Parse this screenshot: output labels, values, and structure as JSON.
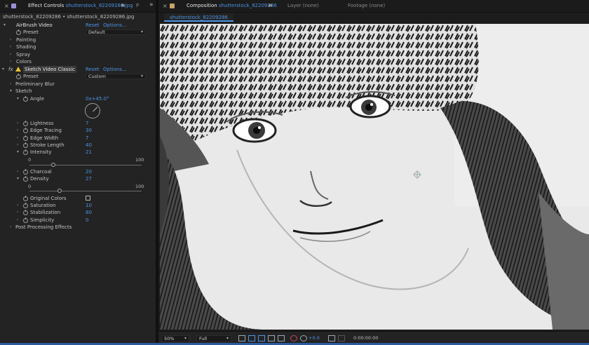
{
  "effect_controls": {
    "tab_title": "Effect Controls",
    "tab_file": "shutterstock_82209286.jpg",
    "next_tab": "P",
    "source_line": "shutterstock_82209286 • shutterstock_82209286.jpg"
  },
  "airbrush": {
    "name": "AirBrush Video",
    "reset": "Reset",
    "options": "Options...",
    "preset_label": "Preset",
    "preset_value": "Default",
    "groups": [
      "Painting",
      "Shading",
      "Spray",
      "Colors"
    ]
  },
  "sketch": {
    "fx": "fx",
    "name": "Sketch Video Classic",
    "reset": "Reset",
    "options": "Options...",
    "preset_label": "Preset",
    "preset_value": "Custom",
    "preliminary_blur": "Preliminary Blur",
    "sketch_group": "Sketch",
    "angle_label": "Angle",
    "angle_value": "0x+45.0°",
    "params_a": [
      {
        "label": "Lightness",
        "value": "7"
      },
      {
        "label": "Edge Tracing",
        "value": "30"
      },
      {
        "label": "Edge Width",
        "value": "7"
      },
      {
        "label": "Stroke Length",
        "value": "40"
      }
    ],
    "intensity": {
      "label": "Intensity",
      "value": "21",
      "min": "0",
      "max": "100",
      "fraction": 0.21
    },
    "charcoal": {
      "label": "Charcoal",
      "value": "20"
    },
    "density": {
      "label": "Density",
      "value": "27",
      "min": "0",
      "max": "100",
      "fraction": 0.27
    },
    "original_colors": "Original Colors",
    "params_b": [
      {
        "label": "Saturation",
        "value": "10"
      },
      {
        "label": "Stabilization",
        "value": "80"
      },
      {
        "label": "Simplicity",
        "value": "0"
      }
    ],
    "post_processing": "Post Processing Effects"
  },
  "composition": {
    "tab_title": "Composition",
    "tab_file": "shutterstock_82209286",
    "layer_tab": "Layer (none)",
    "footage_tab": "Footage (none)",
    "active_subtab": "shutterstock_82209286"
  },
  "viewer_bar": {
    "zoom": "50%",
    "resolution": "Full",
    "exposure": "+0.0",
    "timecode": "0:00:00:00"
  },
  "colors": {
    "accent": "#4c93e6",
    "warning": "#e8c42b"
  }
}
